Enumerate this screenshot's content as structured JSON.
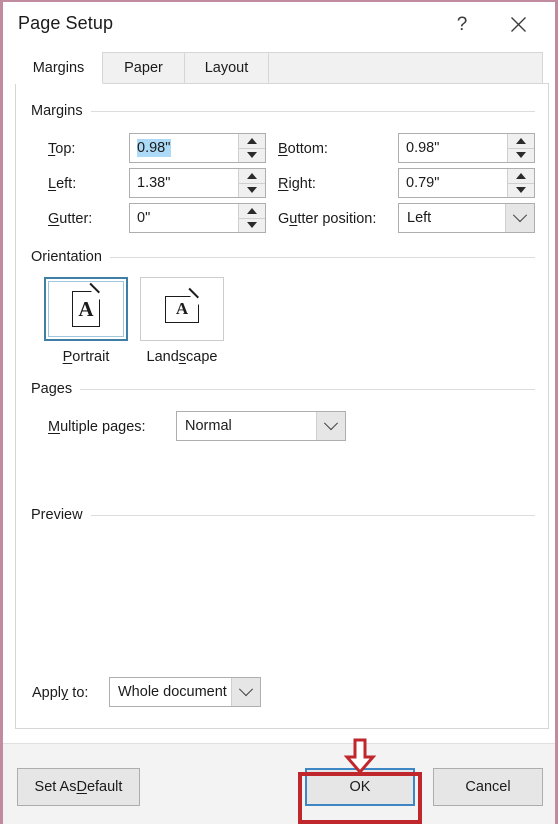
{
  "window": {
    "title": "Page Setup",
    "help_icon": "question-mark-icon",
    "close_icon": "close-x-icon",
    "frame_color": "#c08b9e"
  },
  "tabs": [
    {
      "label": "Margins",
      "active": true
    },
    {
      "label": "Paper",
      "active": false
    },
    {
      "label": "Layout",
      "active": false
    }
  ],
  "margins": {
    "group_label": "Margins",
    "top": {
      "label": "Top:",
      "accel": "T",
      "value": "0.98\"",
      "selected": true
    },
    "bottom": {
      "label": "Bottom:",
      "accel": "B",
      "value": "0.98\"",
      "selected": false
    },
    "left": {
      "label": "Left:",
      "accel": "L",
      "value": "1.38\"",
      "selected": false
    },
    "right": {
      "label": "Right:",
      "accel": "R",
      "value": "0.79\"",
      "selected": false
    },
    "gutter": {
      "label": "Gutter:",
      "accel": "G",
      "value": "0\"",
      "selected": false
    },
    "gutter_position": {
      "label": "Gutter position:",
      "accel": "u",
      "value": "Left"
    }
  },
  "orientation": {
    "group_label": "Orientation",
    "selected": "Portrait",
    "options": [
      {
        "label": "Portrait",
        "accel": "P",
        "icon": "portrait-page-icon",
        "glyph": "A",
        "selected": true
      },
      {
        "label": "Landscape",
        "accel": "s",
        "icon": "landscape-page-icon",
        "glyph": "A",
        "selected": false
      }
    ]
  },
  "pages": {
    "group_label": "Pages",
    "multiple_pages": {
      "label": "Multiple pages:",
      "accel": "M",
      "value": "Normal"
    }
  },
  "preview": {
    "group_label": "Preview",
    "page_icon": "document-preview-page"
  },
  "apply_to": {
    "label": "Apply to:",
    "accel": "y",
    "value": "Whole document"
  },
  "buttons": {
    "set_as_default": {
      "label": "Set As Default",
      "accel": "D"
    },
    "ok": {
      "label": "OK",
      "focused": true
    },
    "cancel": {
      "label": "Cancel"
    }
  },
  "annotation": {
    "highlight_color": "#c0272d",
    "arrow_icon": "down-arrow-annotation",
    "target": "OK"
  }
}
